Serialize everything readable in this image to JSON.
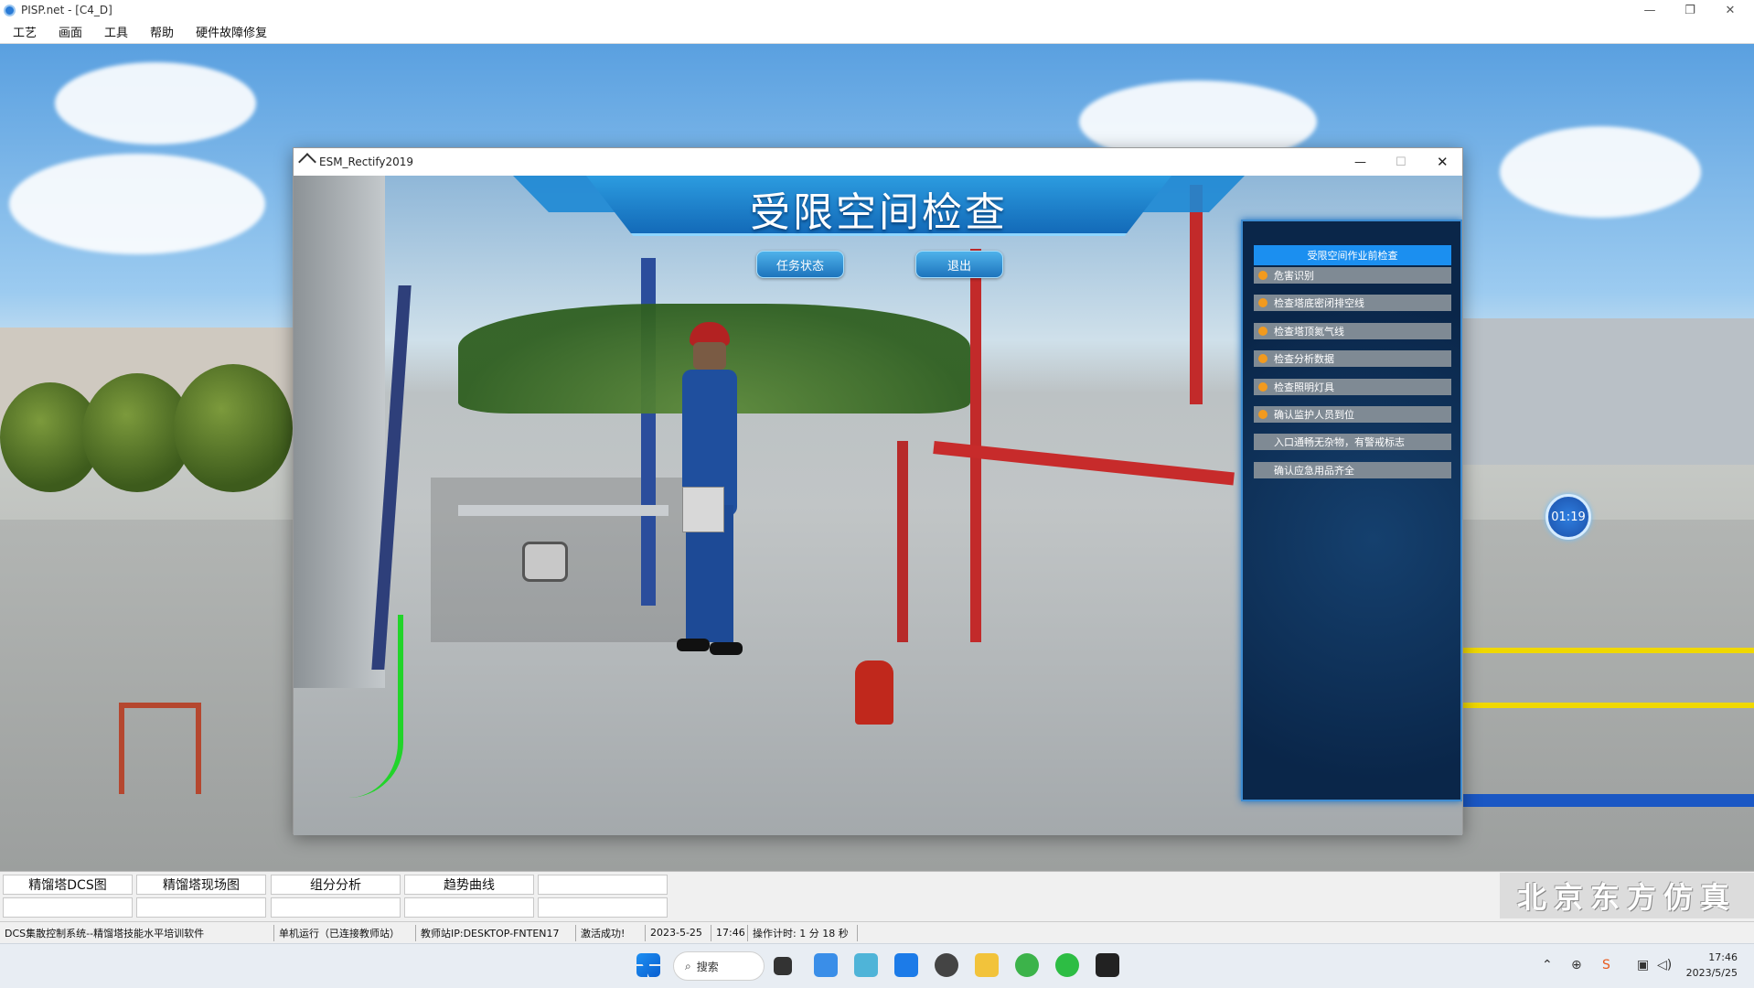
{
  "app": {
    "title": "PISP.net - [C4_D]"
  },
  "menu": [
    "工艺",
    "画面",
    "工具",
    "帮助",
    "硬件故障修复"
  ],
  "window_controls": {
    "minimize": "—",
    "restore": "❐",
    "close": "✕"
  },
  "dialog": {
    "title": "ESM_Rectify2019",
    "controls": {
      "minimize": "—",
      "maximize": "☐",
      "close": "✕"
    },
    "banner_title": "受限空间检查",
    "buttons": {
      "task_status": "任务状态",
      "exit": "退出"
    },
    "panel": {
      "header": "受限空间作业前检查",
      "tasks": [
        {
          "label": "危害识别",
          "dot": true
        },
        {
          "label": "检查塔底密闭排空线",
          "dot": true
        },
        {
          "label": "检查塔顶氮气线",
          "dot": true
        },
        {
          "label": "检查分析数据",
          "dot": true
        },
        {
          "label": "检查照明灯具",
          "dot": true
        },
        {
          "label": "确认监护人员到位",
          "dot": true
        },
        {
          "label": "入口通畅无杂物，有警戒标志",
          "dot": false
        },
        {
          "label": "确认应急用品齐全",
          "dot": false
        }
      ]
    }
  },
  "timer": "01:19",
  "bottom_tabs": [
    "精馏塔DCS图",
    "精馏塔现场图",
    "组分分析",
    "趋势曲线",
    "",
    "",
    "",
    "",
    "",
    ""
  ],
  "brand": "北京东方仿真",
  "status": {
    "system": "DCS集散控制系统--精馏塔技能水平培训软件",
    "mode": "单机运行（已连接教师站）",
    "teacher": "教师站IP:DESKTOP-FNTEN17",
    "activation": "激活成功!",
    "date": "2023-5-25",
    "time": "17:46",
    "timer": "操作计时: 1 分 18 秒"
  },
  "taskbar": {
    "search": "搜索",
    "clock_time": "17:46",
    "clock_date": "2023/5/25"
  },
  "colors": {
    "accent": "#1b8ff0",
    "panel": "#0a2649",
    "dot": "#f29a1e"
  }
}
